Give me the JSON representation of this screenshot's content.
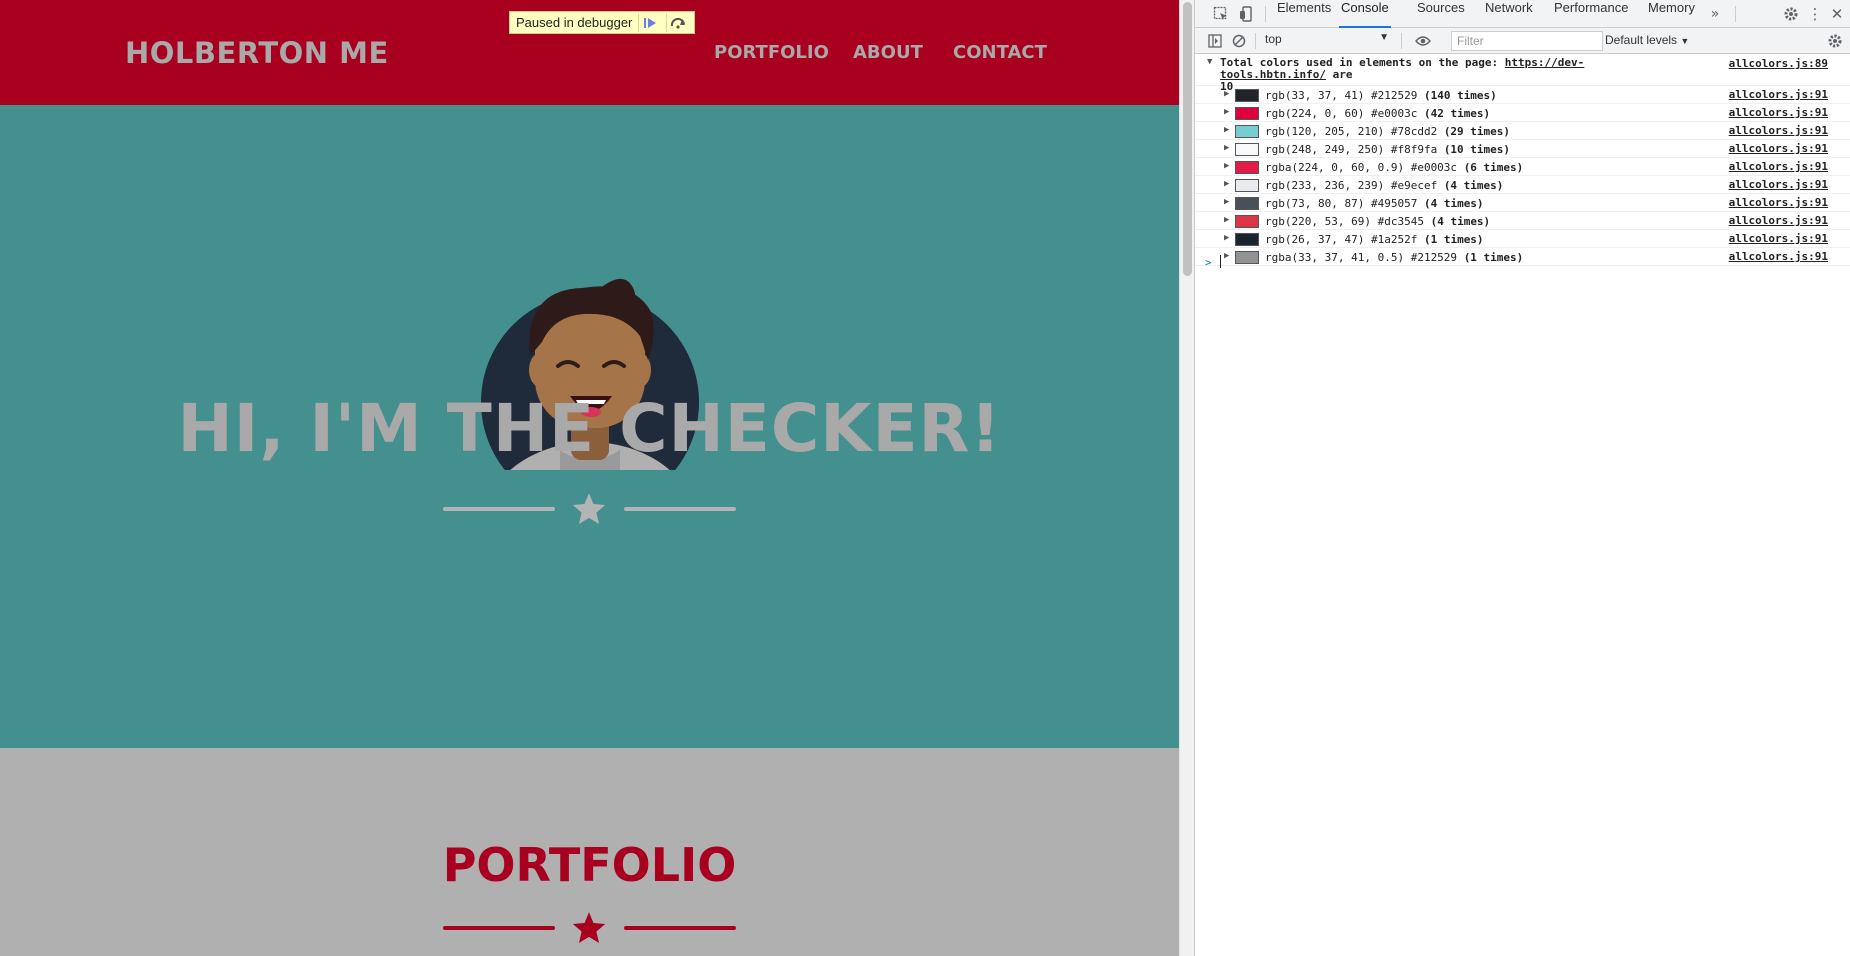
{
  "page": {
    "brand": "HOLBERTON ME",
    "nav": [
      "PORTFOLIO",
      "ABOUT",
      "CONTACT"
    ],
    "hero_title": "HI, I'M THE CHECKER!",
    "portfolio_title": "PORTFOLIO",
    "colors": {
      "navbar": "#a8001e",
      "masthead": "#43908f",
      "muted_text": "#a9a9a9",
      "accent": "#a8001e"
    }
  },
  "debugger": {
    "label": "Paused in debugger",
    "resume_icon": "resume-icon",
    "step_over_icon": "step-over-icon"
  },
  "devtools": {
    "tabs": [
      "Elements",
      "Console",
      "Sources",
      "Network",
      "Performance",
      "Memory"
    ],
    "active_tab": "Console",
    "more_tabs_icon": "double-chevron-icon",
    "context": "top",
    "filter_placeholder": "Filter",
    "levels": "Default levels"
  },
  "console": {
    "summary_prefix": "Total colors used in elements on the page:",
    "summary_url": "https://dev-tools.hbtn.info/",
    "summary_suffix": "are",
    "summary_count": "10",
    "summary_source": "allcolors.js:89",
    "rows": [
      {
        "swatch": "#212529",
        "text": "rgb(33, 37, 41) #212529",
        "count": "(140 times)",
        "source": "allcolors.js:91"
      },
      {
        "swatch": "#e0003c",
        "text": "rgb(224, 0, 60) #e0003c",
        "count": "(42 times)",
        "source": "allcolors.js:91"
      },
      {
        "swatch": "#78cdd2",
        "text": "rgb(120, 205, 210) #78cdd2",
        "count": "(29 times)",
        "source": "allcolors.js:91"
      },
      {
        "swatch": "#f8f9fa",
        "text": "rgb(248, 249, 250) #f8f9fa",
        "count": "(10 times)",
        "source": "allcolors.js:91"
      },
      {
        "swatch": "#e41a47",
        "text": "rgba(224, 0, 60, 0.9) #e0003c",
        "count": "(6 times)",
        "source": "allcolors.js:91"
      },
      {
        "swatch": "#e9ecef",
        "text": "rgb(233, 236, 239) #e9ecef",
        "count": "(4 times)",
        "source": "allcolors.js:91"
      },
      {
        "swatch": "#495057",
        "text": "rgb(73, 80, 87) #495057",
        "count": "(4 times)",
        "source": "allcolors.js:91"
      },
      {
        "swatch": "#dc3545",
        "text": "rgb(220, 53, 69) #dc3545",
        "count": "(4 times)",
        "source": "allcolors.js:91"
      },
      {
        "swatch": "#1a252f",
        "text": "rgb(26, 37, 47) #1a252f",
        "count": "(1 times)",
        "source": "allcolors.js:91"
      },
      {
        "swatch": "#909294",
        "text": "rgba(33, 37, 41, 0.5) #212529",
        "count": "(1 times)",
        "source": "allcolors.js:91"
      }
    ],
    "prompt": ">"
  }
}
